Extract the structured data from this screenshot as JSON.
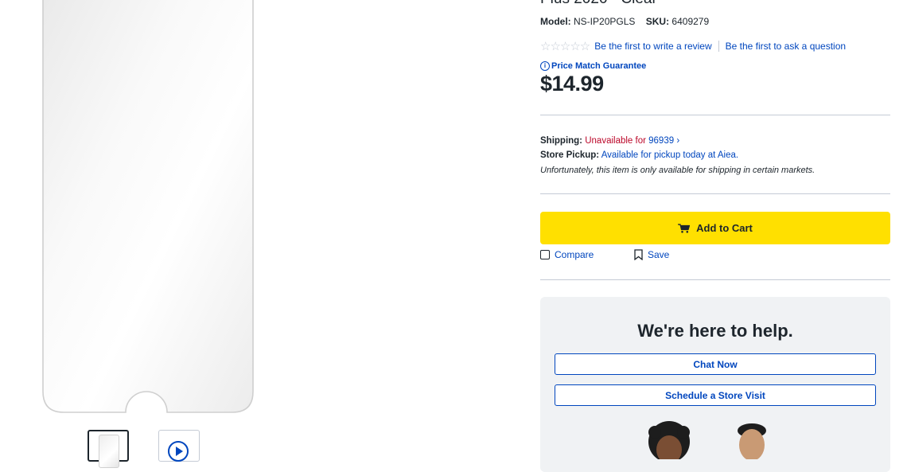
{
  "product": {
    "title_partial": "Plus 2020 - Clear",
    "model_label": "Model:",
    "model_value": "NS-IP20PGLS",
    "sku_label": "SKU:",
    "sku_value": "6409279",
    "stars": "☆☆☆☆☆",
    "review_link": "Be the first to write a review",
    "question_link": "Be the first to ask a question",
    "price_match": "Price Match Guarantee",
    "price": "$14.99"
  },
  "fulfillment": {
    "shipping_label": "Shipping:",
    "shipping_status": "Unavailable for",
    "shipping_zip": "96939 ›",
    "pickup_label": "Store Pickup:",
    "pickup_text": "Available for pickup today at Aiea.",
    "note": "Unfortunately, this item is only available for shipping in certain markets."
  },
  "actions": {
    "add_to_cart": "Add to Cart",
    "compare": "Compare",
    "save": "Save"
  },
  "help": {
    "title": "We're here to help.",
    "chat": "Chat Now",
    "visit": "Schedule a Store Visit"
  },
  "colors": {
    "link_blue": "#0046be",
    "cart_yellow": "#ffe000",
    "unavailable_red": "#bb0628"
  },
  "icons": [
    "info-icon",
    "cart-icon",
    "bookmark-icon",
    "play-icon",
    "star-icon"
  ]
}
